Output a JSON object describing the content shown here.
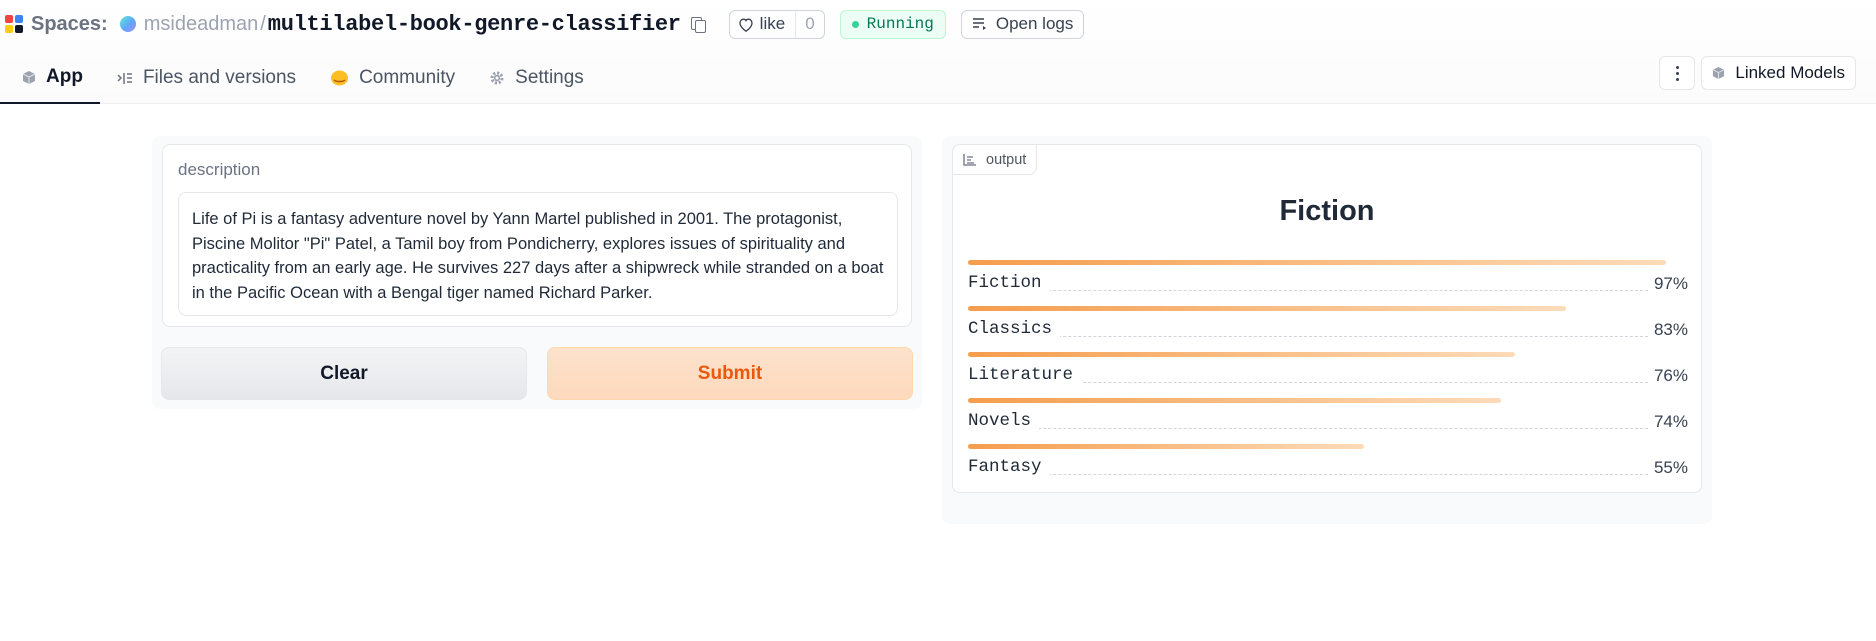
{
  "header": {
    "spaces_label": "Spaces:",
    "owner": "msideadman",
    "separator": "/",
    "repo": "multilabel-book-genre-classifier",
    "like_label": "like",
    "like_count": "0",
    "status": "Running",
    "open_logs": "Open logs",
    "tabs": [
      {
        "label": "App",
        "icon": "cube-icon"
      },
      {
        "label": "Files and versions",
        "icon": "files-icon"
      },
      {
        "label": "Community",
        "icon": "community-icon"
      },
      {
        "label": "Settings",
        "icon": "gear-icon"
      }
    ],
    "linked_models": "Linked Models"
  },
  "input": {
    "label": "description",
    "value": "Life of Pi is a fantasy adventure novel by Yann Martel published in 2001. The protagonist, Piscine Molitor \"Pi\" Patel, a Tamil boy from Pondicherry, explores issues of spirituality and practicality from an early age. He survives 227 days after a shipwreck while stranded on a boat in the Pacific Ocean with a Bengal tiger named Richard Parker."
  },
  "buttons": {
    "clear": "Clear",
    "submit": "Submit"
  },
  "output": {
    "tag": "output",
    "top_label": "Fiction",
    "confidences": [
      {
        "label": "Fiction",
        "pct": "97%",
        "value": 0.97
      },
      {
        "label": "Classics",
        "pct": "83%",
        "value": 0.83
      },
      {
        "label": "Literature",
        "pct": "76%",
        "value": 0.76
      },
      {
        "label": "Novels",
        "pct": "74%",
        "value": 0.74
      },
      {
        "label": "Fantasy",
        "pct": "55%",
        "value": 0.55
      }
    ]
  },
  "colors": {
    "accent": "#ea580c",
    "running": "#047857"
  }
}
